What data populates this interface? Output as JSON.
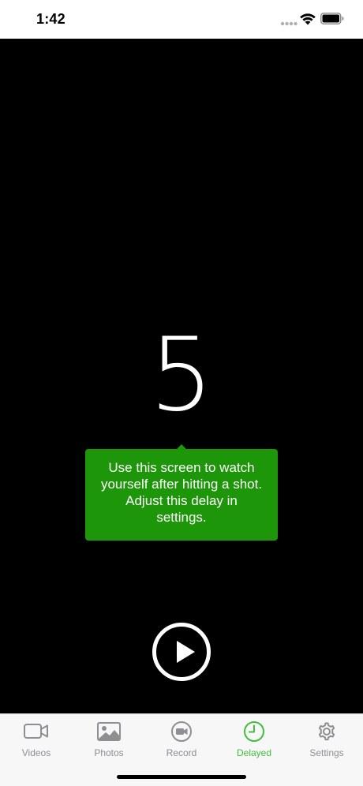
{
  "status_bar": {
    "time": "1:42"
  },
  "delay": {
    "countdown": "5"
  },
  "tooltip": {
    "lines": [
      "Use this screen to watch",
      "yourself after hitting a shot.",
      "Adjust this delay in",
      "settings."
    ],
    "color": "#1e960a"
  },
  "player": {
    "play_icon": "play-icon"
  },
  "tab_bar": {
    "active_color": "#3fbf3a",
    "inactive_color": "#8e8e93",
    "tabs": [
      {
        "label": "Videos",
        "icon": "video-camera-icon",
        "active": false
      },
      {
        "label": "Photos",
        "icon": "photo-icon",
        "active": false
      },
      {
        "label": "Record",
        "icon": "record-icon",
        "active": false
      },
      {
        "label": "Delayed",
        "icon": "clock-icon",
        "active": true
      },
      {
        "label": "Settings",
        "icon": "gear-icon",
        "active": false
      }
    ]
  }
}
